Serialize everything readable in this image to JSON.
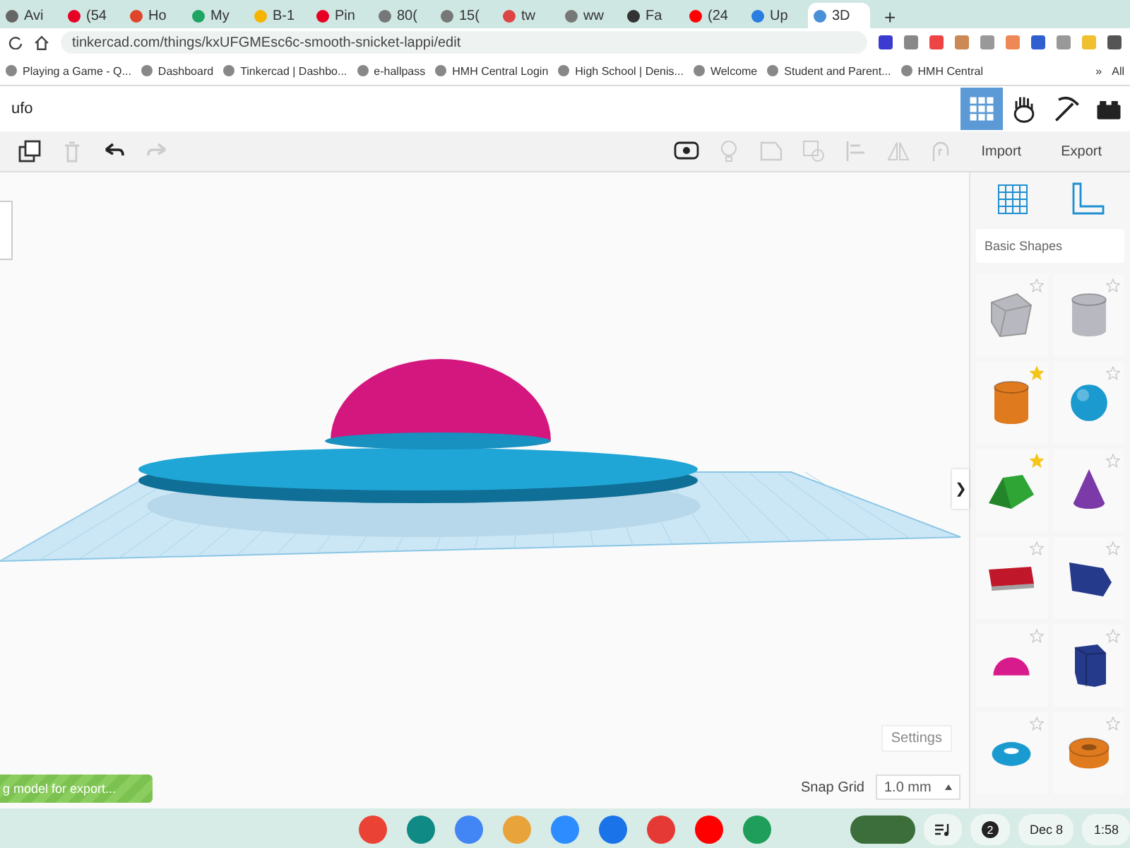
{
  "browser": {
    "tabs": [
      {
        "label": "Avi",
        "selected": false
      },
      {
        "label": "(54",
        "selected": false
      },
      {
        "label": "Ho",
        "selected": false
      },
      {
        "label": "My",
        "selected": false
      },
      {
        "label": "B-1",
        "selected": false
      },
      {
        "label": "Pin",
        "selected": false
      },
      {
        "label": "80(",
        "selected": false
      },
      {
        "label": "15(",
        "selected": false
      },
      {
        "label": "tw",
        "selected": false
      },
      {
        "label": "ww",
        "selected": false
      },
      {
        "label": "Fa",
        "selected": false
      },
      {
        "label": "(24",
        "selected": false
      },
      {
        "label": "Up",
        "selected": false
      },
      {
        "label": "3D",
        "selected": true
      }
    ],
    "new_tab": "+",
    "address": "tinkercad.com/things/kxUFGMEsc6c-smooth-snicket-lappi/edit",
    "bookmarks": [
      "Playing a Game - Q...",
      "Dashboard",
      "Tinkercad | Dashbo...",
      "e-hallpass",
      "HMH Central Login",
      "High School | Denis...",
      "Welcome",
      "Student and Parent...",
      "HMH Central"
    ],
    "bookmarks_more": "»",
    "all_bookmarks": "All"
  },
  "app": {
    "design_name": "ufo",
    "views": [
      {
        "kind": "grid",
        "selected": true
      },
      {
        "kind": "hand",
        "selected": false
      },
      {
        "kind": "pickaxe",
        "selected": false
      },
      {
        "kind": "brick",
        "selected": false
      }
    ],
    "toolbar": {
      "import": "Import",
      "export": "Export"
    },
    "shapes_library": "Basic Shapes",
    "shapes": [
      {
        "kind": "box",
        "color": "#b8b8c0",
        "starred": false
      },
      {
        "kind": "cylinder",
        "color": "#b8b8c0",
        "starred": false
      },
      {
        "kind": "cylinder",
        "color": "#e07a1e",
        "starred": true
      },
      {
        "kind": "sphere",
        "color": "#1b9ad0",
        "starred": false
      },
      {
        "kind": "roof",
        "color": "#2ea535",
        "starred": true
      },
      {
        "kind": "cone",
        "color": "#7b3aa8",
        "starred": false
      },
      {
        "kind": "text",
        "color": "#c0182a",
        "starred": false
      },
      {
        "kind": "wedge",
        "color": "#253a8a",
        "starred": false
      },
      {
        "kind": "halfsphere",
        "color": "#d81b8c",
        "starred": false
      },
      {
        "kind": "prism",
        "color": "#253a8a",
        "starred": false
      },
      {
        "kind": "torus",
        "color": "#1b9ad0",
        "starred": false
      },
      {
        "kind": "tube",
        "color": "#e07a1e",
        "starred": false
      }
    ],
    "collapse": "❯",
    "settings": "Settings",
    "snap_grid_label": "Snap Grid",
    "snap_grid_value": "1.0 mm",
    "export_progress": "g model for export..."
  },
  "taskbar": {
    "notifications": "2",
    "date": "Dec 8",
    "time": "1:58"
  }
}
